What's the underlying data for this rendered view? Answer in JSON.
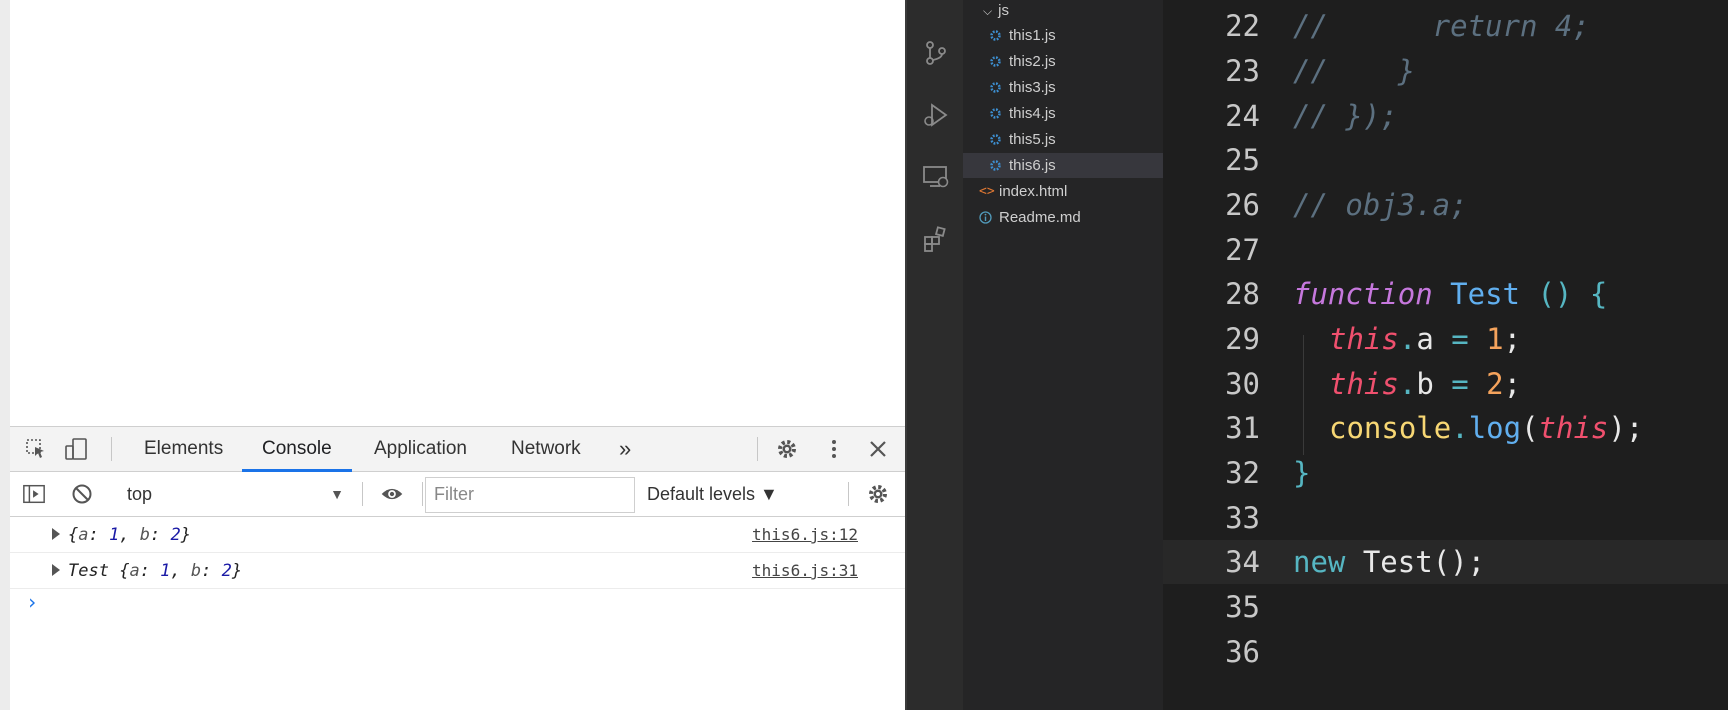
{
  "devtools": {
    "tabs": [
      {
        "label": "Elements"
      },
      {
        "label": "Console"
      },
      {
        "label": "Application"
      },
      {
        "label": "Network"
      }
    ],
    "more_tabs": "»",
    "context": "top",
    "filter_placeholder": "Filter",
    "levels_label": "Default levels ▼",
    "console_messages": [
      {
        "prefix": "",
        "source": "this6.js:12"
      },
      {
        "prefix": "Test ",
        "source": "this6.js:31"
      }
    ],
    "object_keys": {
      "a": "a",
      "b": "b"
    },
    "object_values": {
      "a": "1",
      "b": "2"
    },
    "prompt": "›"
  },
  "explorer": {
    "folder": "js",
    "files": [
      {
        "name": "this1.js"
      },
      {
        "name": "this2.js"
      },
      {
        "name": "this3.js"
      },
      {
        "name": "this4.js"
      },
      {
        "name": "this5.js"
      },
      {
        "name": "this6.js",
        "selected": true
      },
      {
        "name": "index.html"
      },
      {
        "name": "Readme.md"
      }
    ]
  },
  "editor": {
    "line_numbers": [
      "22",
      "23",
      "24",
      "25",
      "26",
      "27",
      "28",
      "29",
      "30",
      "31",
      "32",
      "33",
      "34",
      "35",
      "36"
    ],
    "c22": "//      return 4;",
    "c23": "//    }",
    "c24": "// });",
    "c26": "// obj3.a;",
    "kw_function": "function",
    "fn_name": "Test",
    "sig_punc": " () {",
    "kw_this": "this",
    "prop_a": "a",
    "prop_b": "b",
    "eq": " = ",
    "val1": "1",
    "val2": "2",
    "semi": ";",
    "dot": ".",
    "console_obj": "console",
    "log_method": "log",
    "paren_open": "(",
    "paren_close": ")",
    "close_brace": "}",
    "kw_new": "new",
    "new_call": " Test();"
  },
  "colors": {
    "accent": "#1a73e8",
    "editor_bg": "#1e1e1e",
    "sidebar_bg": "#252526"
  }
}
